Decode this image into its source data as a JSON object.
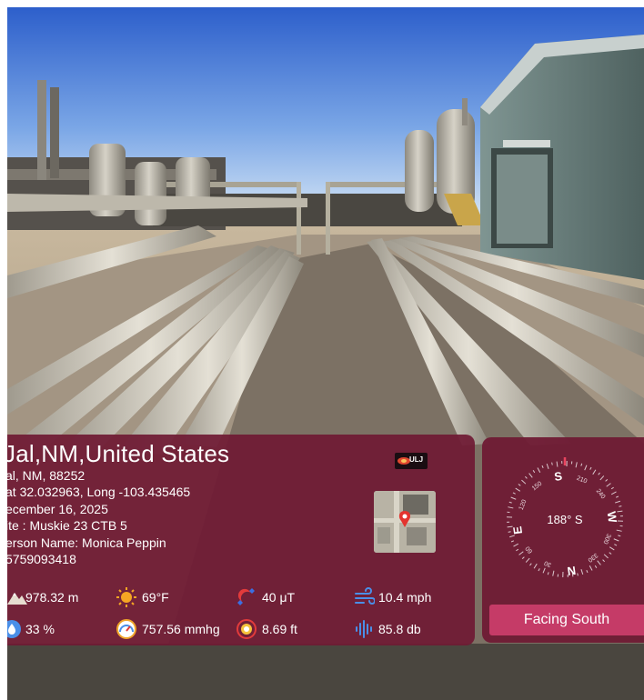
{
  "location": {
    "title": "Jal,NM,United States",
    "lines": [
      "al, NM, 88252",
      "at 32.032963, Long -103.435465",
      "ecember 16, 2025",
      "ite : Muskie 23 CTB 5",
      "erson Name: Monica Peppin",
      "5759093418"
    ]
  },
  "metrics": {
    "elevation": "978.32 m",
    "temperature": "69°F",
    "magnetic": "40 μT",
    "wind": "10.4 mph",
    "humidity": "33 %",
    "pressure": "757.56 mmhg",
    "accuracy": "8.69 ft",
    "sound": "85.8 db"
  },
  "compass": {
    "heading_deg": 188,
    "heading_label": "188° S",
    "cardinals": [
      "N",
      "E",
      "S",
      "W"
    ],
    "degree_labels": [
      "30",
      "60",
      "120",
      "150",
      "210",
      "240",
      "300",
      "330"
    ],
    "facing_label": "Facing South"
  },
  "logo": {
    "text": "ULJ"
  },
  "colors": {
    "panel": "#6f1a34",
    "facing_button": "#c53b67",
    "sky_top": "#2f63cf",
    "sky_bottom": "#dbe9f6"
  },
  "icons": {
    "elevation": "mountain-icon",
    "temperature": "sun-icon",
    "magnetic": "magnet-icon",
    "wind": "wind-icon",
    "humidity": "humidity-icon",
    "pressure": "gauge-icon",
    "accuracy": "target-icon",
    "sound": "sound-wave-icon"
  }
}
